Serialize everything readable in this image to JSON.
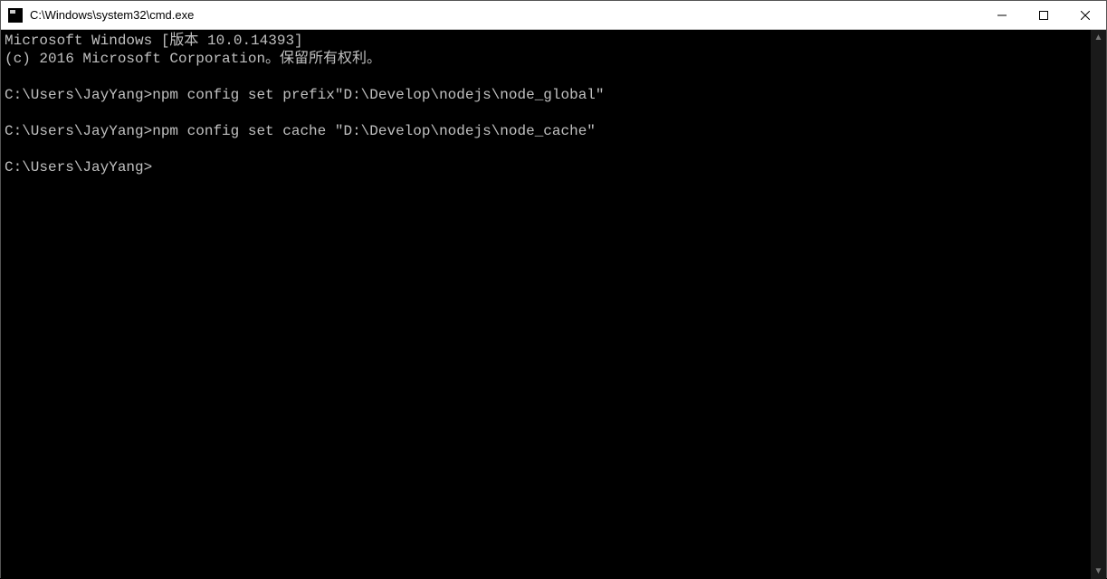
{
  "window": {
    "title": "C:\\Windows\\system32\\cmd.exe"
  },
  "terminal": {
    "lines": [
      "Microsoft Windows [版本 10.0.14393]",
      "(c) 2016 Microsoft Corporation。保留所有权利。",
      "",
      "C:\\Users\\JayYang>npm config set prefix\"D:\\Develop\\nodejs\\node_global\"",
      "",
      "C:\\Users\\JayYang>npm config set cache \"D:\\Develop\\nodejs\\node_cache\"",
      "",
      "C:\\Users\\JayYang>"
    ]
  }
}
